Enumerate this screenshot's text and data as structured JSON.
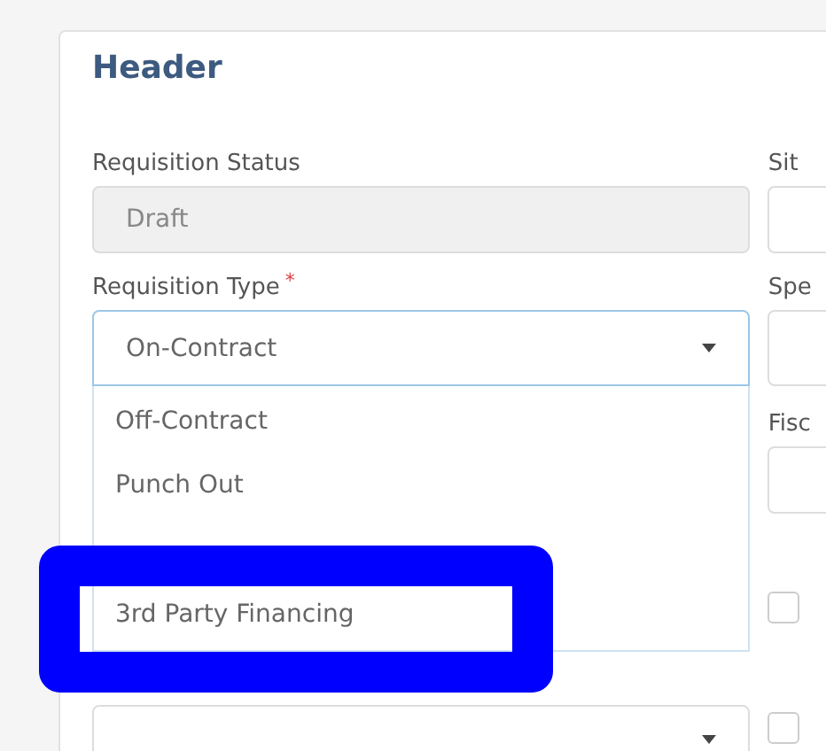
{
  "section": {
    "title": "Header"
  },
  "left_fields": [
    {
      "kind": "text",
      "label": "Requisition Status",
      "value": "Draft",
      "disabled": true
    },
    {
      "kind": "select",
      "label": "Requisition Type",
      "required_mark": "*",
      "value": "On-Contract",
      "expanded": true,
      "options": [
        {
          "label": "Off-Contract"
        },
        {
          "label": "Punch Out"
        },
        {
          "label": "3rd Party Financing"
        }
      ]
    },
    {
      "kind": "select",
      "expanded": false
    }
  ],
  "right_fields": [
    {
      "kind": "text",
      "label": "Sit"
    },
    {
      "kind": "text",
      "label": "Spe"
    },
    {
      "kind": "text",
      "label": "Fisc"
    },
    {
      "kind": "checkbox",
      "checked": false
    },
    {
      "kind": "checkbox",
      "checked": false
    }
  ]
}
